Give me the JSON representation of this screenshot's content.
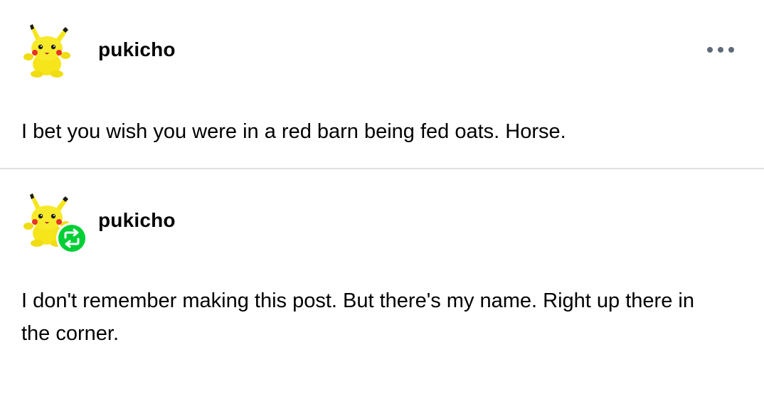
{
  "colors": {
    "background": "#ffffff",
    "text": "#000000",
    "divider": "#e0e0e0",
    "meatball_icon": "#5f6b7a",
    "reblog_badge": "#00cf35",
    "avatar_yellow": "#f5e51a"
  },
  "posts": [
    {
      "username": "pukicho",
      "avatar_icon": "pikachu-plush-avatar-icon",
      "has_menu": true,
      "menu_icon": "meatball-menu-icon",
      "text": "I bet you wish you were in a red barn being fed oats. Horse."
    },
    {
      "username": "pukicho",
      "avatar_icon": "pikachu-plush-avatar-icon",
      "reblog_icon": "reblog-icon",
      "text": "I don't remember making this post. But there's my name. Right up there in the corner."
    }
  ]
}
